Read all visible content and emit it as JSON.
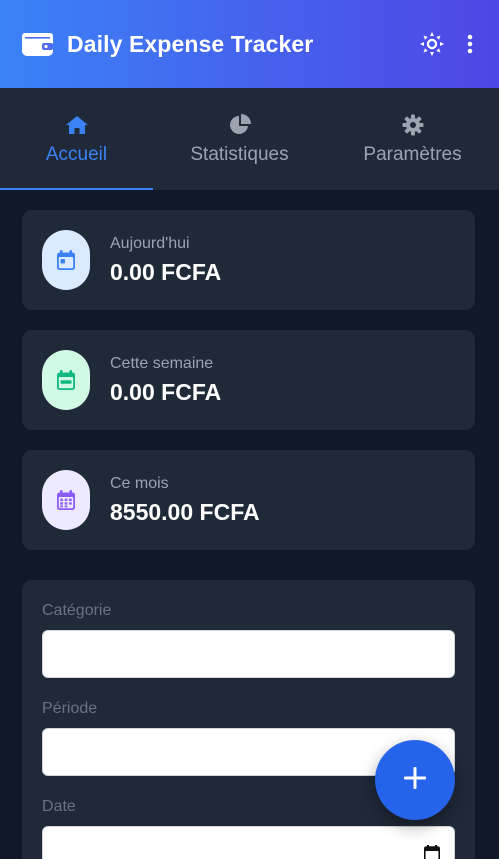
{
  "header": {
    "title": "Daily Expense Tracker",
    "icons": [
      "wallet-icon",
      "sun-icon",
      "more-vertical-icon"
    ]
  },
  "tabs": [
    {
      "label": "Accueil",
      "icon": "home-icon",
      "active": true
    },
    {
      "label": "Statistiques",
      "icon": "pie-chart-icon",
      "active": false
    },
    {
      "label": "Paramètres",
      "icon": "gear-icon",
      "active": false
    }
  ],
  "summary": {
    "today": {
      "label": "Aujourd'hui",
      "value": "0.00 FCFA",
      "icon": "calendar-day-icon",
      "color": "#3b82f6"
    },
    "week": {
      "label": "Cette semaine",
      "value": "0.00 FCFA",
      "icon": "calendar-week-icon",
      "color": "#10b981"
    },
    "month": {
      "label": "Ce mois",
      "value": "8550.00 FCFA",
      "icon": "calendar-month-icon",
      "color": "#8b5cf6"
    }
  },
  "filters": {
    "category_label": "Catégorie",
    "category_value": "",
    "period_label": "Période",
    "period_value": "",
    "date_label": "Date",
    "date_value": ""
  },
  "fab": {
    "label": "+",
    "icon": "plus-icon"
  },
  "colors": {
    "accent": "#3b82f6",
    "header_start": "#3b82f6",
    "header_end": "#4f46e5",
    "background": "#111827",
    "card": "#1f2937"
  }
}
